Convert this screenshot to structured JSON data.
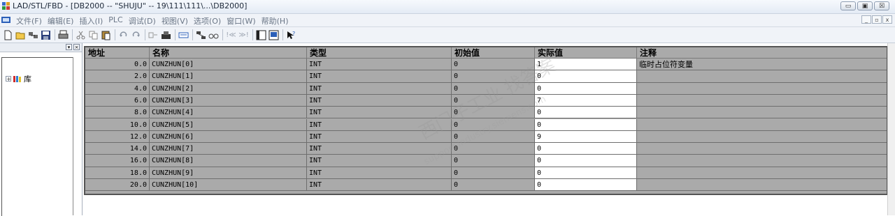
{
  "window": {
    "title": "LAD/STL/FBD  - [DB2000 -- \"SHUJU\" -- 19\\111\\111\\...\\DB2000]",
    "min_label": "▭",
    "max_label": "▣",
    "close_label": "☒"
  },
  "menu": {
    "items": [
      "文件(F)",
      "编辑(E)",
      "插入(I)",
      "PLC",
      "调试(D)",
      "视图(V)",
      "选项(O)",
      "窗口(W)",
      "帮助(H)"
    ],
    "mdi_min": "_",
    "mdi_restore": "▫",
    "mdi_close": "x"
  },
  "left_panel": {
    "expander": "+",
    "library_label": "库"
  },
  "table": {
    "headers": {
      "address": "地址",
      "name": "名称",
      "type": "类型",
      "initial": "初始值",
      "actual": "实际值",
      "comment": "注释"
    },
    "rows": [
      {
        "address": "0.0",
        "name": "CUNZHUN[0]",
        "type": "INT",
        "initial": "0",
        "actual": "1",
        "comment": "临时占位符变量"
      },
      {
        "address": "2.0",
        "name": "CUNZHUN[1]",
        "type": "INT",
        "initial": "0",
        "actual": "0",
        "comment": ""
      },
      {
        "address": "4.0",
        "name": "CUNZHUN[2]",
        "type": "INT",
        "initial": "0",
        "actual": "0",
        "comment": ""
      },
      {
        "address": "6.0",
        "name": "CUNZHUN[3]",
        "type": "INT",
        "initial": "0",
        "actual": "7",
        "comment": ""
      },
      {
        "address": "8.0",
        "name": "CUNZHUN[4]",
        "type": "INT",
        "initial": "0",
        "actual": "0",
        "comment": ""
      },
      {
        "address": "10.0",
        "name": "CUNZHUN[5]",
        "type": "INT",
        "initial": "0",
        "actual": "0",
        "comment": ""
      },
      {
        "address": "12.0",
        "name": "CUNZHUN[6]",
        "type": "INT",
        "initial": "0",
        "actual": "9",
        "comment": ""
      },
      {
        "address": "14.0",
        "name": "CUNZHUN[7]",
        "type": "INT",
        "initial": "0",
        "actual": "0",
        "comment": ""
      },
      {
        "address": "16.0",
        "name": "CUNZHUN[8]",
        "type": "INT",
        "initial": "0",
        "actual": "0",
        "comment": ""
      },
      {
        "address": "18.0",
        "name": "CUNZHUN[9]",
        "type": "INT",
        "initial": "0",
        "actual": "0",
        "comment": ""
      },
      {
        "address": "20.0",
        "name": "CUNZHUN[10]",
        "type": "INT",
        "initial": "0",
        "actual": "0",
        "comment": ""
      }
    ]
  },
  "watermark": {
    "text_cn": "西门子工业 找答案",
    "text_url": "support.industry.siemens.com"
  },
  "colors": {
    "grid_bg": "#aaaaaa",
    "actual_bg": "#ffffff",
    "frame": "#555555"
  }
}
